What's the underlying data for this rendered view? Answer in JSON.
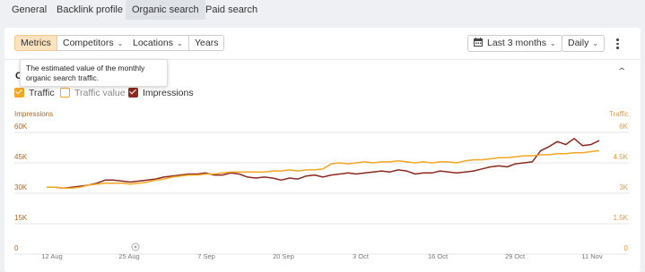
{
  "tabs": [
    {
      "label": "General",
      "active": false
    },
    {
      "label": "Backlink profile",
      "active": false
    },
    {
      "label": "Organic search",
      "active": true
    },
    {
      "label": "Paid search",
      "active": false
    }
  ],
  "toolbar": {
    "metrics": "Metrics",
    "competitors": "Competitors",
    "locations": "Locations",
    "years": "Years",
    "date_range": "Last 3 months",
    "interval": "Daily"
  },
  "section_title": "O",
  "tooltip": "The estimated value of the monthly organic search traffic.",
  "legend": [
    {
      "label": "Traffic",
      "checked": true,
      "color": "#f5a623"
    },
    {
      "label": "Traffic value",
      "checked": false,
      "color": "#f5a623"
    },
    {
      "label": "Impressions",
      "checked": true,
      "color": "#8b2a1f"
    }
  ],
  "chart_data": {
    "type": "line",
    "x": [
      "12 Aug",
      "25 Aug",
      "7 Sep",
      "20 Sep",
      "3 Oct",
      "16 Oct",
      "29 Oct",
      "11 Nov"
    ],
    "left_axis": {
      "title": "Impressions",
      "ticks": [
        "60K",
        "45K",
        "30K",
        "15K",
        "0"
      ],
      "ylim": [
        0,
        60000
      ],
      "color": "#b5651d"
    },
    "right_axis": {
      "title": "Traffic",
      "ticks": [
        "6K",
        "4.5K",
        "3K",
        "1.5K",
        "0"
      ],
      "ylim": [
        0,
        6000
      ],
      "color": "#e89a2c"
    },
    "series": [
      {
        "name": "Impressions",
        "axis": "left",
        "color": "#8b2a1f",
        "values": [
          33000,
          33000,
          32500,
          33000,
          33500,
          34000,
          35000,
          36500,
          36500,
          36000,
          35500,
          36000,
          36500,
          37000,
          38000,
          38500,
          39000,
          39500,
          39500,
          40000,
          39000,
          39000,
          40000,
          39500,
          38000,
          37500,
          38000,
          37500,
          36500,
          37500,
          37000,
          38500,
          39000,
          38000,
          39000,
          39500,
          40000,
          39500,
          40000,
          40500,
          41000,
          40500,
          41500,
          41000,
          39500,
          40000,
          40000,
          41000,
          40500,
          40000,
          40500,
          41000,
          42000,
          43000,
          43500,
          43000,
          44500,
          45000,
          45500,
          51000,
          53000,
          55500,
          54000,
          57000,
          53500,
          54000,
          56000
        ]
      },
      {
        "name": "Traffic",
        "axis": "right",
        "color": "#f5a623",
        "values": [
          3300,
          3300,
          3250,
          3250,
          3300,
          3400,
          3450,
          3500,
          3500,
          3500,
          3450,
          3500,
          3550,
          3650,
          3700,
          3800,
          3850,
          3900,
          3900,
          3950,
          3950,
          4000,
          4050,
          4050,
          4050,
          4050,
          4050,
          4100,
          4100,
          4150,
          4100,
          4150,
          4150,
          4200,
          4450,
          4500,
          4450,
          4500,
          4550,
          4500,
          4550,
          4550,
          4600,
          4550,
          4500,
          4550,
          4500,
          4550,
          4550,
          4500,
          4600,
          4650,
          4650,
          4700,
          4750,
          4750,
          4800,
          4850,
          4850,
          4900,
          4900,
          4950,
          4950,
          5000,
          5000,
          5050,
          5100
        ]
      }
    ]
  }
}
